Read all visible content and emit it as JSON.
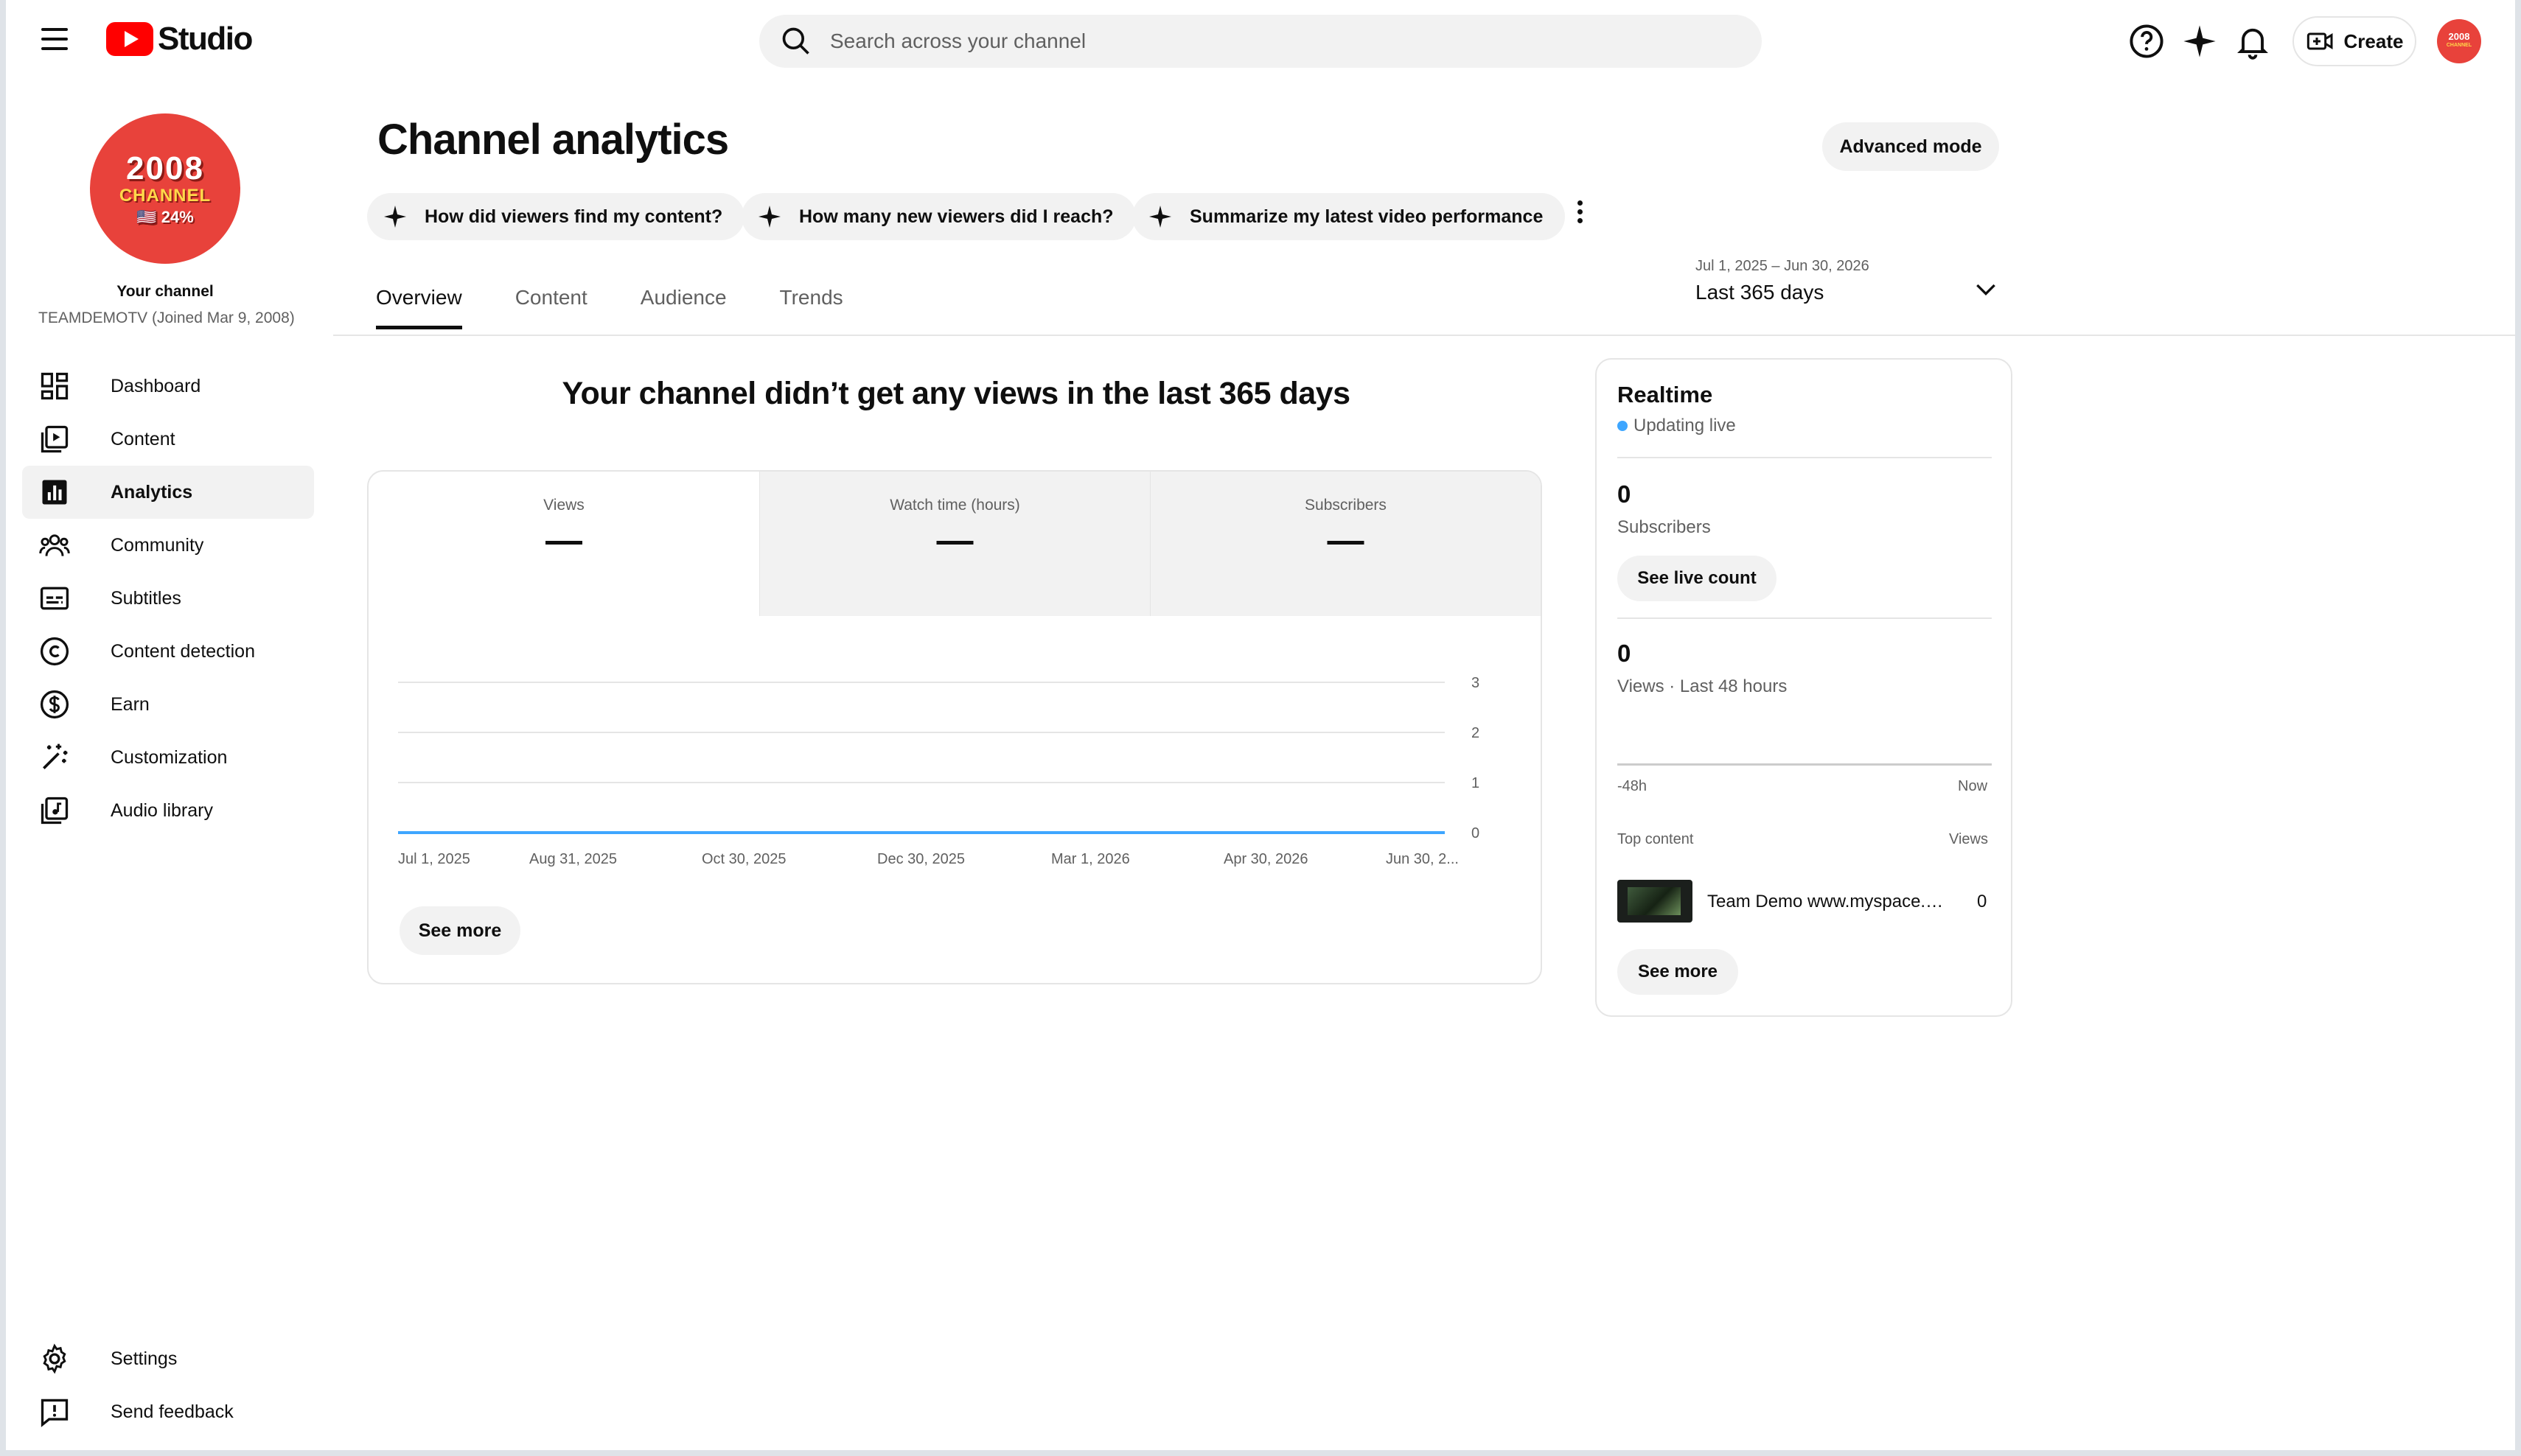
{
  "header": {
    "logo_text": "Studio",
    "search_placeholder": "Search across your channel",
    "create_label": "Create",
    "avatar_text": "2008",
    "avatar_sub": "CHANNEL"
  },
  "sidebar": {
    "channel_title": "Your channel",
    "channel_subtitle": "TEAMDEMOTV (Joined Mar 9, 2008)",
    "avatar_year": "2008",
    "avatar_label": "CHANNEL",
    "avatar_pct": "🇺🇸 24%",
    "items": [
      {
        "label": "Dashboard",
        "icon": "dashboard-icon"
      },
      {
        "label": "Content",
        "icon": "content-icon"
      },
      {
        "label": "Analytics",
        "icon": "analytics-icon",
        "active": true
      },
      {
        "label": "Community",
        "icon": "community-icon"
      },
      {
        "label": "Subtitles",
        "icon": "subtitles-icon"
      },
      {
        "label": "Content detection",
        "icon": "copyright-icon"
      },
      {
        "label": "Earn",
        "icon": "dollar-icon"
      },
      {
        "label": "Customization",
        "icon": "magic-wand-icon"
      },
      {
        "label": "Audio library",
        "icon": "audio-library-icon"
      }
    ],
    "bottom_items": [
      {
        "label": "Settings",
        "icon": "gear-icon"
      },
      {
        "label": "Send feedback",
        "icon": "feedback-icon"
      }
    ]
  },
  "main": {
    "title": "Channel analytics",
    "advanced_mode": "Advanced mode",
    "chips": [
      "How did viewers find my content?",
      "How many new viewers did I reach?",
      "Summarize my latest video performance"
    ],
    "date_range_small": "Jul 1, 2025 – Jun 30, 2026",
    "date_range_big": "Last 365 days",
    "tabs": [
      "Overview",
      "Content",
      "Audience",
      "Trends"
    ],
    "active_tab": "Overview",
    "no_views_message": "Your channel didn’t get any views in the last 365 days",
    "metrics": [
      {
        "label": "Views",
        "value": "—"
      },
      {
        "label": "Watch time (hours)",
        "value": "—"
      },
      {
        "label": "Subscribers",
        "value": "—"
      }
    ],
    "see_more": "See more"
  },
  "chart_data": {
    "type": "line",
    "title": "",
    "xlabel": "",
    "ylabel": "",
    "x_tick_labels": [
      "Jul 1, 2025",
      "Aug 31, 2025",
      "Oct 30, 2025",
      "Dec 30, 2025",
      "Mar 1, 2026",
      "Apr 30, 2026",
      "Jun 30, 2..."
    ],
    "y_tick_labels": [
      "0",
      "1",
      "2",
      "3"
    ],
    "ylim": [
      0,
      3
    ],
    "x": [
      "Jul 1, 2025",
      "Jun 30, 2026"
    ],
    "series": [
      {
        "values": [
          0,
          0
        ],
        "color": "#3ea6ff"
      }
    ],
    "grid": true,
    "y_axis_side": "right"
  },
  "realtime": {
    "title": "Realtime",
    "live_label": "Updating live",
    "subscribers_value": "0",
    "subscribers_label": "Subscribers",
    "see_live_count": "See live count",
    "views_value": "0",
    "views_label": "Views · Last 48 hours",
    "axis_left": "-48h",
    "axis_right": "Now",
    "top_content_label": "Top content",
    "views_col_label": "Views",
    "video_title": "Team Demo www.myspace.com/teamdemo",
    "video_views": "0",
    "see_more": "See more"
  }
}
